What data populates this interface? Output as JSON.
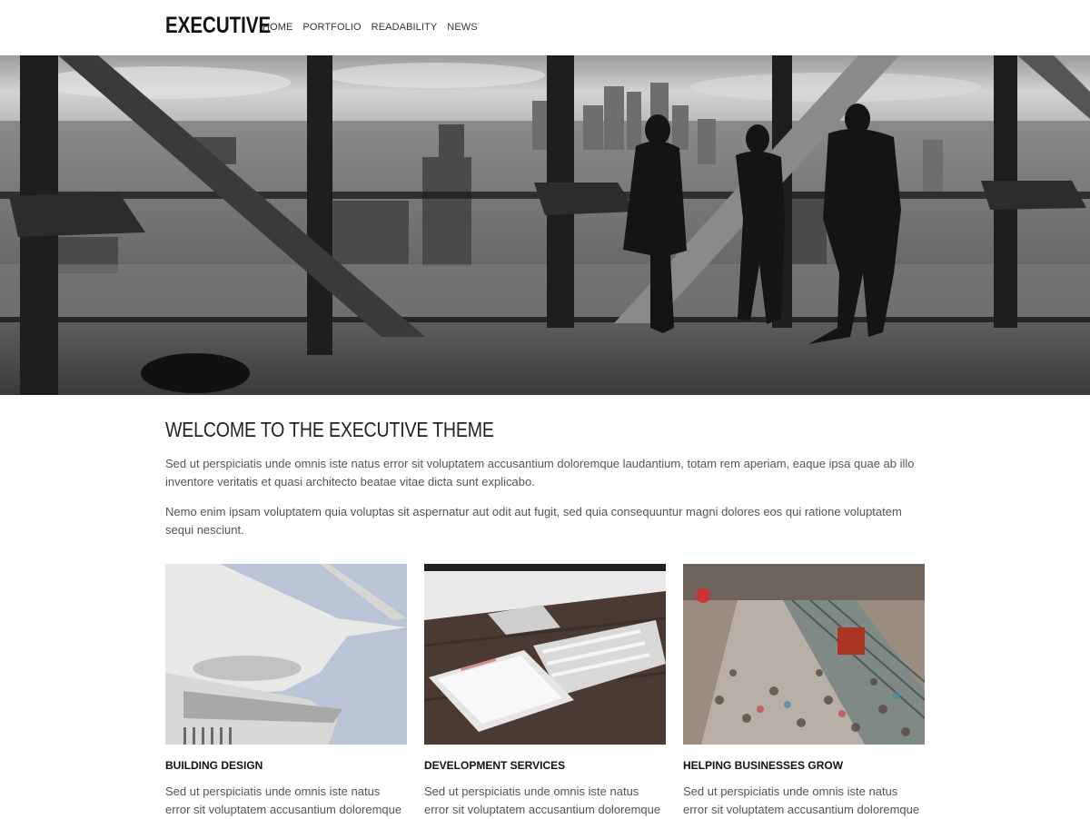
{
  "header": {
    "logo": "EXECUTIVE",
    "nav": [
      "HOME",
      "PORTFOLIO",
      "READABILITY",
      "NEWS"
    ]
  },
  "welcome": {
    "title": "WELCOME TO THE EXECUTIVE THEME",
    "paragraph_1": "Sed ut perspiciatis unde omnis iste natus error sit voluptatem accusantium doloremque laudantium, totam rem aperiam, eaque ipsa quae ab illo inventore veritatis et quasi architecto beatae vitae dicta sunt explicabo.",
    "paragraph_2": "Nemo enim ipsam voluptatem quia voluptas sit aspernatur aut odit aut fugit, sed quia consequuntur magni dolores eos qui ratione voluptatem sequi nesciunt."
  },
  "cards": [
    {
      "title": "BUILDING DESIGN",
      "text": "Sed ut perspiciatis unde omnis iste natus error sit voluptatem accusantium doloremque"
    },
    {
      "title": "DEVELOPMENT SERVICES",
      "text": "Sed ut perspiciatis unde omnis iste natus error sit voluptatem accusantium doloremque"
    },
    {
      "title": "HELPING BUSINESSES GROW",
      "text": "Sed ut perspiciatis unde omnis iste natus error sit voluptatem accusantium doloremque"
    }
  ]
}
